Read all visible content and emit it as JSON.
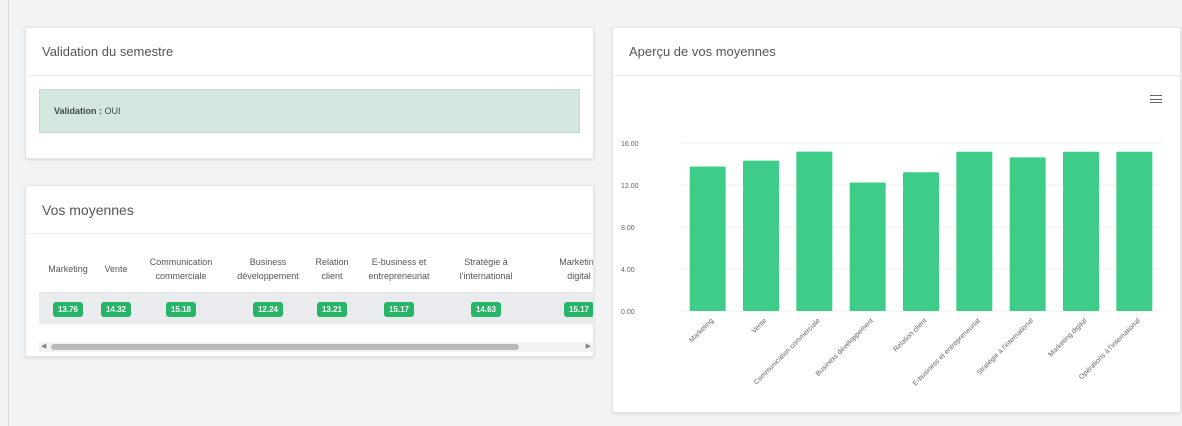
{
  "validation": {
    "title": "Validation du semestre",
    "label": "Validation :",
    "value": "OUI"
  },
  "averages": {
    "title": "Vos moyennes",
    "columns": [
      {
        "line1": "Marketing",
        "line2": "",
        "value": "13.76"
      },
      {
        "line1": "Vente",
        "line2": "",
        "value": "14.32"
      },
      {
        "line1": "Communication",
        "line2": "commerciale",
        "value": "15.18"
      },
      {
        "line1": "Business",
        "line2": "développement",
        "value": "12.24"
      },
      {
        "line1": "Relation",
        "line2": "client",
        "value": "13.21"
      },
      {
        "line1": "E-business et",
        "line2": "entrepreneuriat",
        "value": "15.17"
      },
      {
        "line1": "Stratégie à",
        "line2": "l'international",
        "value": "14.63"
      },
      {
        "line1": "Marketing",
        "line2": "digital",
        "value": "15.17"
      }
    ]
  },
  "chart": {
    "title": "Aperçu de vos moyennes",
    "menu_icon": "hamburger-menu-icon",
    "bar_color": "#3dcd89"
  },
  "chart_data": {
    "type": "bar",
    "categories": [
      "Marketing",
      "Vente",
      "Communication commerciale",
      "Business développement",
      "Relation client",
      "E-business et entrepreneuriat",
      "Stratégie à l'international",
      "Marketing digital",
      "Opérations à l'international"
    ],
    "values": [
      13.76,
      14.32,
      15.18,
      12.24,
      13.21,
      15.17,
      14.63,
      15.17,
      15.17
    ],
    "yticks": [
      "0.00",
      "4.00",
      "8.00",
      "12.00",
      "16.00"
    ],
    "ylim": [
      0,
      16
    ],
    "grid": true,
    "title": "",
    "xlabel": "",
    "ylabel": ""
  }
}
